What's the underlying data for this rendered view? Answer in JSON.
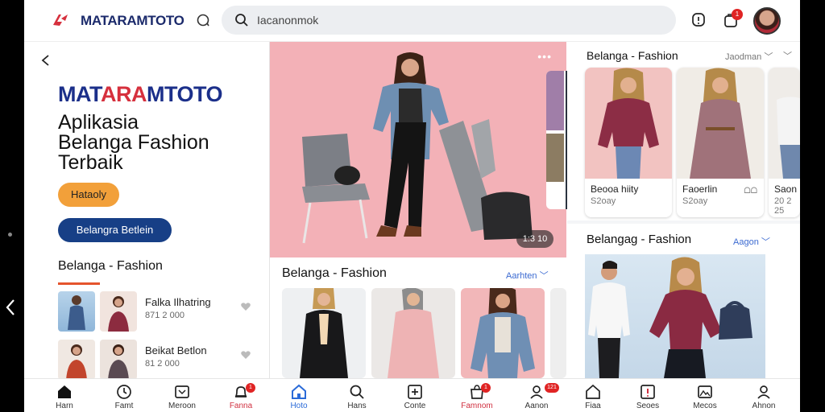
{
  "topbar": {
    "brand": "MATARAMTOTO",
    "search_text": "Iacanonmok",
    "bag_badge": "1"
  },
  "left": {
    "hero_brand": "MATARAMTOTO",
    "hero_title_lines": [
      "Aplikasia",
      "Belanga Fashion",
      "Terbaik"
    ],
    "btn_primary": "Hataoly",
    "btn_secondary": "Belangra Betlein",
    "section_title": "Belanga - Fashion",
    "items": [
      {
        "name": "Falka Ilhatring",
        "price": "871 2 000"
      },
      {
        "name": "Beikat Betlon",
        "price": "81 2 000"
      }
    ]
  },
  "hero": {
    "dots": "•••",
    "time": "1:3 10"
  },
  "center": {
    "title": "Belanga - Fashion",
    "link": "Aarhten ﹀"
  },
  "right": {
    "title1": "Belanga - Fashion",
    "link1": "Jaodman",
    "cards": [
      {
        "name": "Beooa hiity",
        "price": "S2oay",
        "icon": ""
      },
      {
        "name": "Faoerlin",
        "price": "S2oay",
        "icon": "ᗝᗝ"
      },
      {
        "name": "Saon",
        "price": "20 2 25",
        "icon": ""
      }
    ],
    "title2": "Belangag - Fashion",
    "link2": "Aagon ﹀"
  },
  "bottom_nav": [
    {
      "label": "Harn",
      "icon": "home-icon"
    },
    {
      "label": "Famt",
      "icon": "clock-icon"
    },
    {
      "label": "Meroon",
      "icon": "message-icon"
    },
    {
      "label": "Fanna",
      "icon": "bell-icon",
      "badge": "1"
    },
    {
      "label": "Hoto",
      "icon": "home-icon"
    },
    {
      "label": "Hans",
      "icon": "search-icon"
    },
    {
      "label": "Conte",
      "icon": "plus-icon"
    },
    {
      "label": "Famnom",
      "icon": "bag-icon",
      "badge": "1"
    },
    {
      "label": "Aanon",
      "icon": "user-icon",
      "badge": "121"
    },
    {
      "label": "Fiaa",
      "icon": "home-icon"
    },
    {
      "label": "Seoes",
      "icon": "info-icon"
    },
    {
      "label": "Mecos",
      "icon": "gallery-icon"
    },
    {
      "label": "Ahnon",
      "icon": "user-icon"
    }
  ],
  "colors": {
    "brand_blue": "#1b2f8a",
    "accent_red": "#d6303d",
    "primary_orange": "#f2a03a",
    "secondary_blue": "#173f86",
    "hero_pink": "#f3b1b7",
    "link_blue": "#2b6bd8"
  }
}
